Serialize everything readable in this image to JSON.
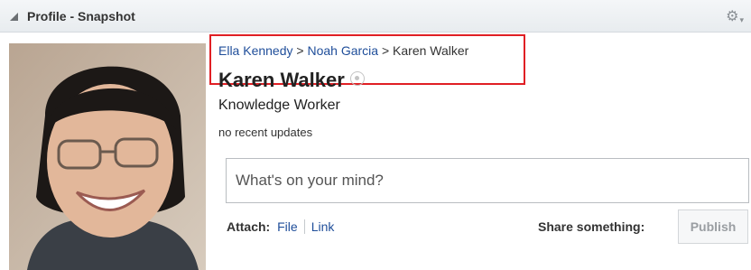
{
  "panel": {
    "title": "Profile - Snapshot"
  },
  "breadcrumb": [
    {
      "label": "Ella Kennedy"
    },
    {
      "label": "Noah Garcia"
    },
    {
      "label": "Karen Walker"
    }
  ],
  "breadcrumb_separator": ">",
  "profile": {
    "name": "Karen Walker",
    "job_title": "Knowledge Worker",
    "recent_updates": "no recent updates"
  },
  "composer": {
    "placeholder": "What's on your mind?",
    "attach_label": "Attach:",
    "attach_file": "File",
    "attach_link": "Link",
    "share_label": "Share something:",
    "publish_label": "Publish"
  },
  "colors": {
    "link": "#1f4e9a",
    "highlight": "#e01f24",
    "header_bg": "#eceff2"
  }
}
